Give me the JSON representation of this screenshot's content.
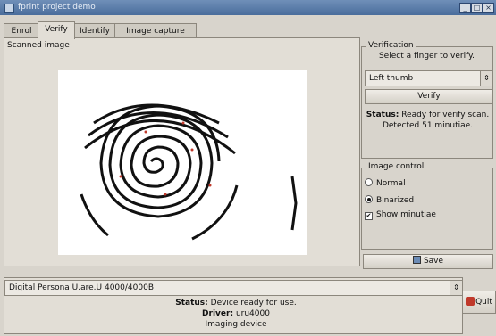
{
  "window": {
    "title": "fprint project demo"
  },
  "tabs": [
    "Enrol",
    "Verify",
    "Identify",
    "Image capture"
  ],
  "scanned_image": {
    "label": "Scanned image"
  },
  "verification": {
    "title": "Verification",
    "prompt": "Select a finger to verify.",
    "finger_select": "Left thumb",
    "verify_button": "Verify",
    "status_label": "Status:",
    "status_text": "Ready for verify scan.",
    "minutiae_text": "Detected 51 minutiae."
  },
  "image_control": {
    "title": "Image control",
    "normal": "Normal",
    "binarized": "Binarized",
    "show_minutiae": "Show minutiae",
    "binarized_selected": true,
    "show_minutiae_checked": true
  },
  "save_button": "Save",
  "device": {
    "selected": "Digital Persona U.are.U 4000/4000B",
    "status_label": "Status:",
    "status_text": "Device ready for use.",
    "driver_label": "Driver:",
    "driver_text": "uru4000",
    "type_text": "Imaging device"
  },
  "quit_button": "Quit",
  "colors": {
    "titlebar": "#4a6d9c",
    "background": "#d8d4cc",
    "quit_icon": "#c0392b"
  }
}
